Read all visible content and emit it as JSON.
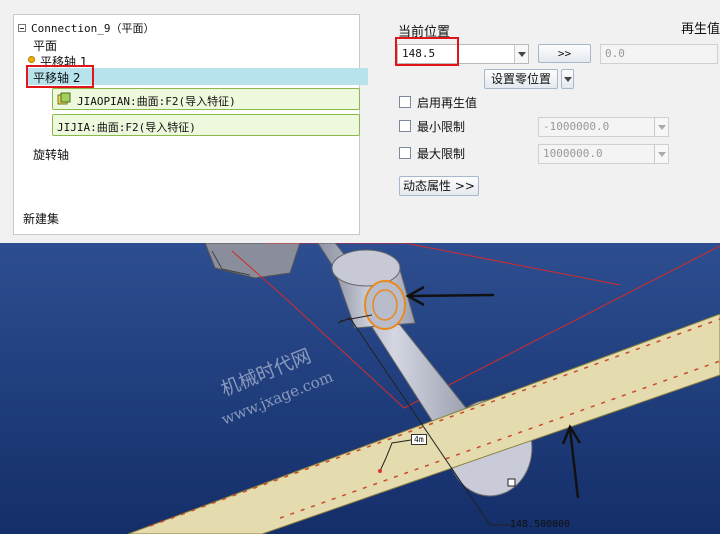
{
  "tree": {
    "title": "Connection_9（平面）",
    "items": [
      {
        "label": "平面"
      },
      {
        "label": "平移轴 1"
      },
      {
        "label": "平移轴 2"
      },
      {
        "label": "旋转轴"
      },
      {
        "label": "新建集"
      }
    ],
    "refs": [
      {
        "label": "JIAOPIAN:曲面:F2(导入特征)"
      },
      {
        "label": "JIJIA:曲面:F2(导入特征)"
      }
    ]
  },
  "panel": {
    "current_position_label": "当前位置",
    "current_position_value": "148.5",
    "arrow_button": ">>",
    "regen_label": "再生值",
    "regen_value": "0.0",
    "set_zero_button": "设置零位置",
    "enable_regen_label": "启用再生值",
    "min_limit_label": "最小限制",
    "min_limit_value": "-1000000.0",
    "max_limit_label": "最大限制",
    "max_limit_value": "1000000.0",
    "dynamic_props_button": "动态属性 >>"
  },
  "viewport": {
    "watermark_cn": "机械时代网",
    "watermark_url": "www.jxage.com",
    "dimension_value": "148.500000",
    "small_label": "4m"
  },
  "colors": {
    "highlight_box": "#e0161b",
    "selection_bg": "#b7e4ec",
    "viewport_bg": "#1f3e7d",
    "rail_fill": "#e4dcae"
  }
}
